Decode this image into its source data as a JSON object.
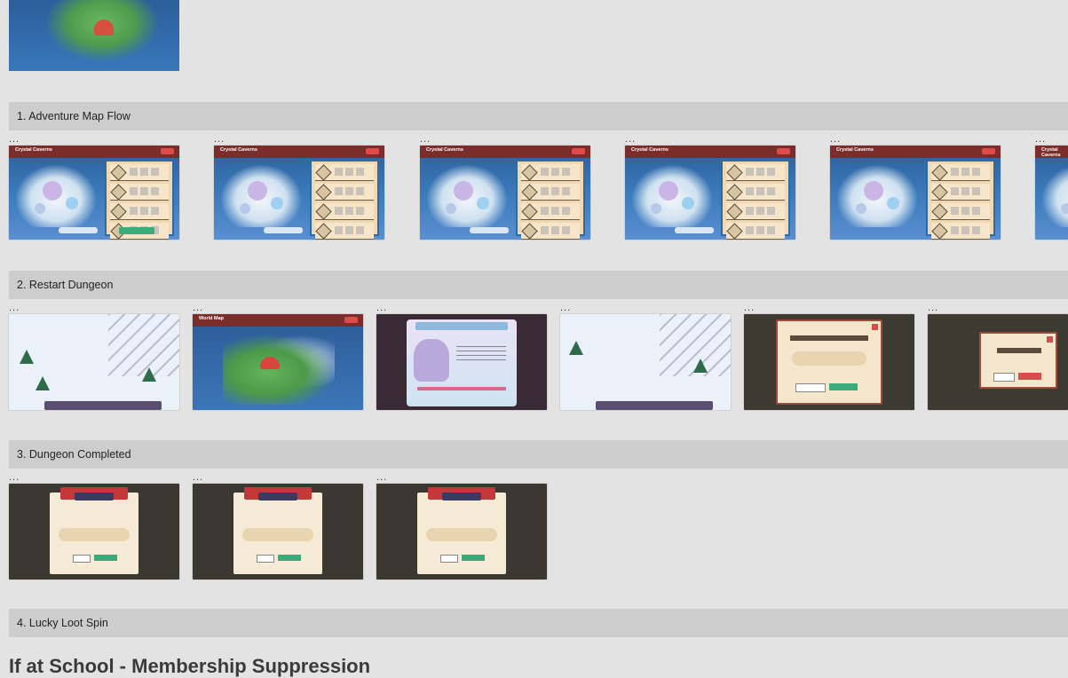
{
  "sections": [
    {
      "label": "1. Adventure Map Flow"
    },
    {
      "label": "2. Restart Dungeon"
    },
    {
      "label": "3. Dungeon Completed"
    },
    {
      "label": "4. Lucky Loot Spin"
    }
  ],
  "thumb_menu_label": "...",
  "frame_texts": {
    "adventure_header": "Crystal Caverns",
    "world_map_header": "World Map"
  },
  "page_title": "If at School - Membership Suppression"
}
